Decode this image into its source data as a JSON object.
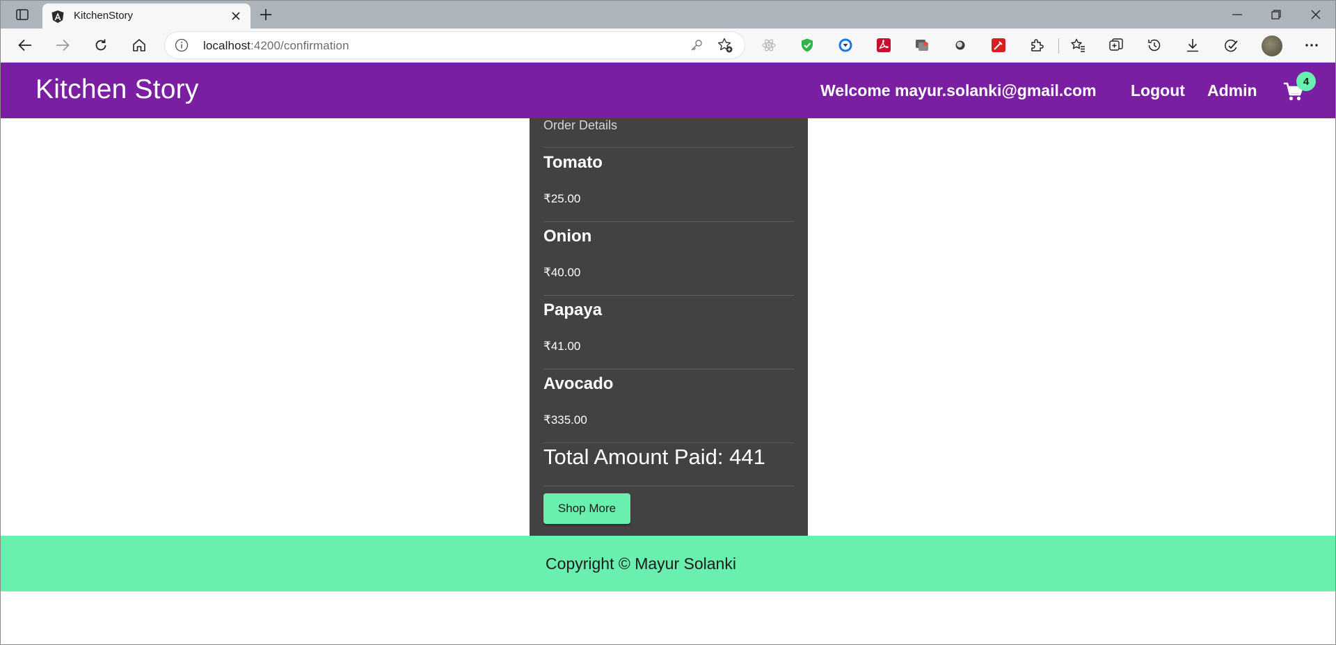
{
  "browser": {
    "tab": {
      "title": "KitchenStory"
    },
    "address_bar": {
      "host": "localhost",
      "path": ":4200/confirmation"
    }
  },
  "app": {
    "brand": "Kitchen Story",
    "nav": {
      "welcome": "Welcome mayur.solanki@gmail.com",
      "logout": "Logout",
      "admin": "Admin",
      "cart_count": "4"
    }
  },
  "order": {
    "subtitle": "Order Details",
    "items": [
      {
        "name": "Tomato",
        "price": "₹25.00"
      },
      {
        "name": "Onion",
        "price": "₹40.00"
      },
      {
        "name": "Papaya",
        "price": "₹41.00"
      },
      {
        "name": "Avocado",
        "price": "₹335.00"
      }
    ],
    "total": "Total Amount Paid: 441",
    "shop_more_label": "Shop More"
  },
  "footer": {
    "text": "Copyright © Mayur Solanki"
  },
  "colors": {
    "header": "#7b1fa2",
    "accent": "#69f0ae",
    "card": "#424242"
  }
}
